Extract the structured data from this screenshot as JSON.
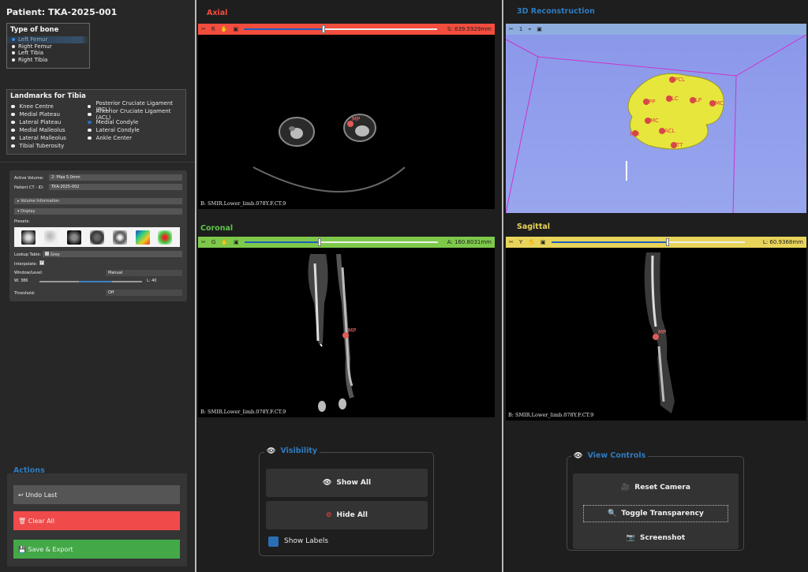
{
  "patient": {
    "title": "Patient: TKA-2025-001"
  },
  "bone": {
    "title": "Type of bone",
    "options": [
      {
        "label": "Left Femur",
        "selected": true
      },
      {
        "label": "Right Femur",
        "selected": false
      },
      {
        "label": "Left Tibia",
        "selected": false
      },
      {
        "label": "Right Tibia",
        "selected": false
      }
    ]
  },
  "landmarks": {
    "title": "Landmarks for Tibia",
    "col1": [
      "Knee Centre",
      "Medial Plateau",
      "Lateral Plateau",
      "Medial Malleolus",
      "Lateral Malleolus",
      "Tibial Tuberosity"
    ],
    "col2": [
      "Posterior Cruciate Ligament (PCL)",
      "Anterior Cruciate Ligament (ACL)",
      "Medial Condyle",
      "Lateral Condyle",
      "Ankle Center"
    ]
  },
  "volume": {
    "active_label": "Active Volume:",
    "active_value": "2: Pfaa 5.0mm",
    "ct_label": "Patient CT - ID:",
    "ct_value": "TKA-2025-002",
    "info": "▸ Volume Information",
    "display": "▾ Display",
    "presets_label": "Presets:",
    "lookup_label": "Lookup Table:",
    "lookup_value": "Grey",
    "interp_label": "Interpolate:",
    "wl_label": "Window/Level:",
    "wl_value": "Manual",
    "w_label": "W:",
    "w_value": "386",
    "l_label": "L:",
    "l_value": "40",
    "threshold_label": "Threshold:",
    "threshold_value": "Off"
  },
  "actions": {
    "title": "Actions",
    "undo": "↩ Undo Last",
    "clear": "🗑 Clear All",
    "save": "💾 Save & Export"
  },
  "views": {
    "axial": {
      "title": "Axial",
      "axis": "R",
      "value": "S: 639.5929mm",
      "position": 0.41,
      "color": "#f24d3d",
      "label": "B: SMIR.Lower_limb.078Y.F.CT.9",
      "marker": "MP"
    },
    "recon": {
      "title": "3D Reconstruction",
      "num": "1",
      "color": "#8faee0",
      "landmarks": [
        "PCL",
        "PP",
        "LC",
        "LP",
        "MC",
        "MC",
        "ACL",
        "MM",
        "TT"
      ]
    },
    "coronal": {
      "title": "Coronal",
      "axis": "G",
      "value": "A: 160.8031mm",
      "position": 0.39,
      "color": "#7ec84a",
      "label": "B: SMIR.Lower_limb.078Y.F.CT.9",
      "marker": "MP"
    },
    "sagittal": {
      "title": "Sagittal",
      "axis": "Y",
      "value": "L: 60.9368mm",
      "position": 0.6,
      "color": "#e8d45a",
      "label": "B: SMIR.Lower_limb.078Y.F.CT.9",
      "marker": "MP"
    }
  },
  "visibility": {
    "title": "Visibility",
    "show_all": "Show All",
    "hide_all": "Hide All",
    "show_labels": "Show Labels"
  },
  "view_controls": {
    "title": "View Controls",
    "reset": "Reset Camera",
    "transparency": "Toggle Transparency",
    "screenshot": "Screenshot"
  }
}
